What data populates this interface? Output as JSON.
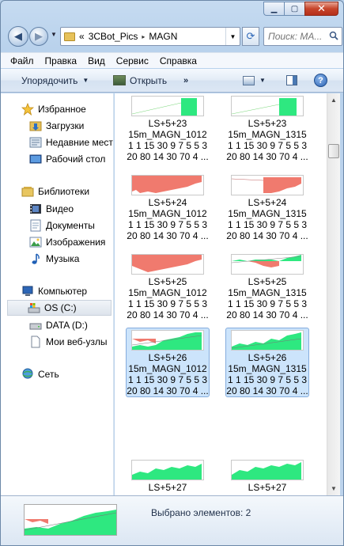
{
  "window": {
    "minimize": "▁",
    "maximize": "▢",
    "close": "✕"
  },
  "address": {
    "overflow": "«",
    "crumbs": [
      "3CBot_Pics",
      "MAGN"
    ],
    "separator": "▸"
  },
  "search": {
    "placeholder": "Поиск: MA..."
  },
  "menu": [
    {
      "label": "Файл"
    },
    {
      "label": "Правка"
    },
    {
      "label": "Вид"
    },
    {
      "label": "Сервис"
    },
    {
      "label": "Справка"
    }
  ],
  "toolbar": {
    "organize": "Упорядочить",
    "open": "Открыть",
    "more": "»",
    "help": "?"
  },
  "nav": {
    "favorites": "Избранное",
    "downloads": "Загрузки",
    "recent": "Недавние мест",
    "desktop": "Рабочий стол",
    "libraries": "Библиотеки",
    "video": "Видео",
    "documents": "Документы",
    "images": "Изображения",
    "music": "Музыка",
    "computer": "Компьютер",
    "drive_c": "OS (C:)",
    "drive_d": "DATA (D:)",
    "web_nodes": "Мои веб-узлы",
    "network": "Сеть"
  },
  "files": [
    {
      "l1": "LS+5+23",
      "l2": "15m_MAGN_1012",
      "l3": "1 1 15 30 9 7 5 5 3",
      "l4": "20 80 14 30 70 4 ...",
      "style": "green-up"
    },
    {
      "l1": "LS+5+23",
      "l2": "15m_MAGN_1315",
      "l3": "1 1 15 30 9 7 5 5 3",
      "l4": "20 80 14 30 70 4 ...",
      "style": "green-up"
    },
    {
      "l1": "LS+5+24",
      "l2": "15m_MAGN_1012",
      "l3": "1 1 15 30 9 7 5 5 3",
      "l4": "20 80 14 30 70 4 ...",
      "style": "red-down"
    },
    {
      "l1": "LS+5+24",
      "l2": "15m_MAGN_1315",
      "l3": "1 1 15 30 9 7 5 5 3",
      "l4": "20 80 14 30 70 4 ...",
      "style": "red-down"
    },
    {
      "l1": "LS+5+25",
      "l2": "15m_MAGN_1012",
      "l3": "1 1 15 30 9 7 5 5 3",
      "l4": "20 80 14 30 70 4 ...",
      "style": "red-down"
    },
    {
      "l1": "LS+5+25",
      "l2": "15m_MAGN_1315",
      "l3": "1 1 15 30 9 7 5 5 3",
      "l4": "20 80 14 30 70 4 ...",
      "style": "mixed"
    },
    {
      "l1": "LS+5+26",
      "l2": "15m_MAGN_1012",
      "l3": "1 1 15 30 9 7 5 5 3",
      "l4": "20 80 14 30 70 4 ...",
      "style": "mixed"
    },
    {
      "l1": "LS+5+26",
      "l2": "15m_MAGN_1315",
      "l3": "1 1 15 30 9 7 5 5 3",
      "l4": "20 80 14 30 70 4 ...",
      "style": "green-full"
    },
    {
      "l1": "LS+5+27",
      "style": "green-full"
    },
    {
      "l1": "LS+5+27",
      "style": "green-full"
    }
  ],
  "details": {
    "status": "Выбрано элементов: 2"
  },
  "colors": {
    "gain": "#2ee880",
    "loss": "#f07a6e",
    "selection": "#cce4fb"
  }
}
